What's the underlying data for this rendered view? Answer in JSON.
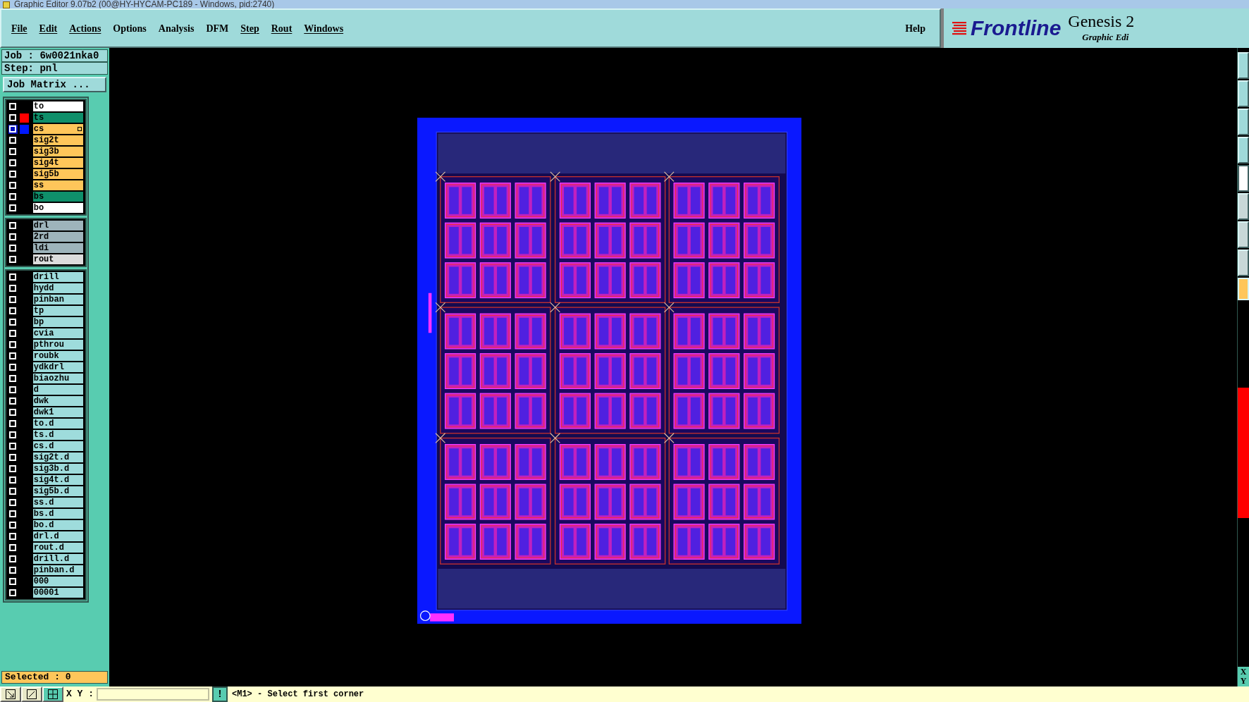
{
  "window": {
    "title": "Graphic Editor 9.07b2 (00@HY-HYCAM-PC189 - Windows, pid:2740)"
  },
  "menu": [
    {
      "label": "File",
      "mnemonic": true
    },
    {
      "label": "Edit",
      "mnemonic": true
    },
    {
      "label": "Actions",
      "mnemonic": true
    },
    {
      "label": "Options",
      "mnemonic": false
    },
    {
      "label": "Analysis",
      "mnemonic": false
    },
    {
      "label": "DFM",
      "mnemonic": false
    },
    {
      "label": "Step",
      "mnemonic": true
    },
    {
      "label": "Rout",
      "mnemonic": true
    },
    {
      "label": "Windows",
      "mnemonic": true
    }
  ],
  "help": "Help",
  "brand": {
    "logo": "Frontline",
    "product": "Genesis 2",
    "subtitle": "Graphic Edi"
  },
  "job": "Job : 6w0021nka0",
  "step": "Step: pnl",
  "job_matrix_button": "Job Matrix ...",
  "layer_groups": [
    [
      {
        "name": "to",
        "kind": "silk",
        "affected": false
      },
      {
        "name": "ts",
        "kind": "mask",
        "affected": false,
        "color": "#ff0000"
      },
      {
        "name": "cs",
        "kind": "signal",
        "affected": true,
        "color": "#0018ff",
        "work_layer": true
      },
      {
        "name": "sig2t",
        "kind": "signal",
        "affected": false
      },
      {
        "name": "sig3b",
        "kind": "signal",
        "affected": false
      },
      {
        "name": "sig4t",
        "kind": "signal",
        "affected": false
      },
      {
        "name": "sig5b",
        "kind": "signal",
        "affected": false
      },
      {
        "name": "ss",
        "kind": "signal",
        "affected": false
      },
      {
        "name": "bs",
        "kind": "mask",
        "affected": false
      },
      {
        "name": "bo",
        "kind": "silk",
        "affected": false
      }
    ],
    [
      {
        "name": "drl",
        "kind": "drill",
        "affected": false
      },
      {
        "name": "2rd",
        "kind": "drill",
        "affected": false
      },
      {
        "name": "ldi",
        "kind": "drill",
        "affected": false
      },
      {
        "name": "rout",
        "kind": "rout",
        "affected": false
      }
    ],
    [
      {
        "name": "drill",
        "kind": "misc",
        "affected": false
      },
      {
        "name": "hydd",
        "kind": "misc",
        "affected": false
      },
      {
        "name": "pinban",
        "kind": "misc",
        "affected": false
      },
      {
        "name": "tp",
        "kind": "misc",
        "affected": false
      },
      {
        "name": "bp",
        "kind": "misc",
        "affected": false
      },
      {
        "name": "cvia",
        "kind": "misc",
        "affected": false
      },
      {
        "name": "pthrou",
        "kind": "misc",
        "affected": false
      },
      {
        "name": "roubk",
        "kind": "misc",
        "affected": false
      },
      {
        "name": "ydkdrl",
        "kind": "misc",
        "affected": false
      },
      {
        "name": "biaozhu",
        "kind": "misc",
        "affected": false
      },
      {
        "name": "d",
        "kind": "misc",
        "affected": false
      },
      {
        "name": "dwk",
        "kind": "misc",
        "affected": false
      },
      {
        "name": "dwk1",
        "kind": "misc",
        "affected": false
      },
      {
        "name": "to.d",
        "kind": "misc",
        "affected": false
      },
      {
        "name": "ts.d",
        "kind": "misc",
        "affected": false
      },
      {
        "name": "cs.d",
        "kind": "misc",
        "affected": false
      },
      {
        "name": "sig2t.d",
        "kind": "misc",
        "affected": false
      },
      {
        "name": "sig3b.d",
        "kind": "misc",
        "affected": false
      },
      {
        "name": "sig4t.d",
        "kind": "misc",
        "affected": false
      },
      {
        "name": "sig5b.d",
        "kind": "misc",
        "affected": false
      },
      {
        "name": "ss.d",
        "kind": "misc",
        "affected": false
      },
      {
        "name": "bs.d",
        "kind": "misc",
        "affected": false
      },
      {
        "name": "bo.d",
        "kind": "misc",
        "affected": false
      },
      {
        "name": "drl.d",
        "kind": "misc",
        "affected": false
      },
      {
        "name": "rout.d",
        "kind": "misc",
        "affected": false
      },
      {
        "name": "drill.d",
        "kind": "misc",
        "affected": false
      },
      {
        "name": "pinban.d",
        "kind": "misc",
        "affected": false
      },
      {
        "name": "000",
        "kind": "misc",
        "affected": false
      },
      {
        "name": "00001",
        "kind": "misc",
        "affected": false
      }
    ]
  ],
  "selected_count": "Selected : 0",
  "coord_axes": [
    "X",
    "Y"
  ],
  "bottom_bar": {
    "xy_label": "X Y :",
    "alert_button": "!",
    "message": "<M1> - Select first corner"
  }
}
